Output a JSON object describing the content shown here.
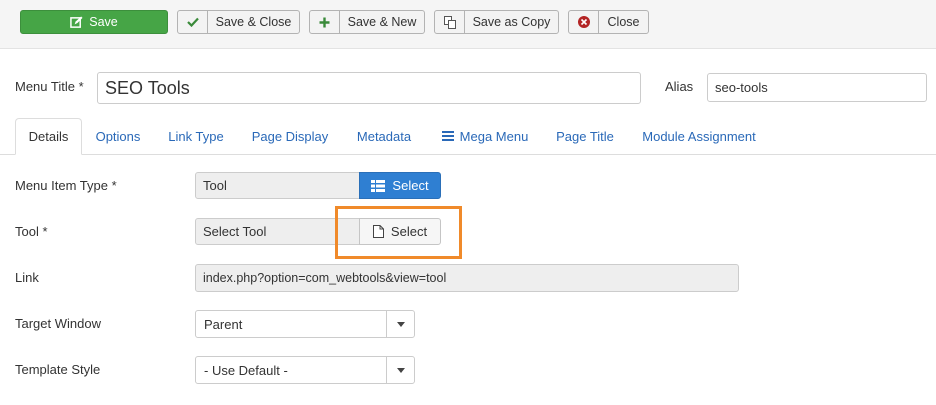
{
  "toolbar": {
    "save": "Save",
    "save_close": "Save & Close",
    "save_new": "Save & New",
    "save_copy": "Save as Copy",
    "close": "Close"
  },
  "header": {
    "menu_title_label": "Menu Title *",
    "menu_title_value": "SEO Tools",
    "alias_label": "Alias",
    "alias_value": "seo-tools"
  },
  "tabs": [
    {
      "label": "Details",
      "active": true
    },
    {
      "label": "Options"
    },
    {
      "label": "Link Type"
    },
    {
      "label": "Page Display"
    },
    {
      "label": "Metadata"
    },
    {
      "label": "Mega Menu",
      "icon": "list-icon"
    },
    {
      "label": "Page Title"
    },
    {
      "label": "Module Assignment"
    }
  ],
  "form": {
    "menu_item_type": {
      "label": "Menu Item Type *",
      "value": "Tool",
      "button": "Select"
    },
    "tool": {
      "label": "Tool *",
      "value": "Select Tool",
      "button": "Select"
    },
    "link": {
      "label": "Link",
      "value": "index.php?option=com_webtools&view=tool"
    },
    "target_window": {
      "label": "Target Window",
      "value": "Parent"
    },
    "template_style": {
      "label": "Template Style",
      "value": "- Use Default -"
    }
  },
  "colors": {
    "save_green": "#46a546",
    "primary_blue": "#2f7fd2",
    "tab_link": "#2a69b8",
    "highlight_orange": "#f08a2a"
  }
}
